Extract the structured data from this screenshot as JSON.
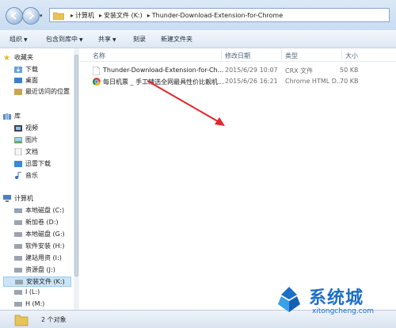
{
  "window": {
    "accent": "#cce4f7"
  },
  "breadcrumb": {
    "items": [
      "计算机",
      "安装文件 (K:)",
      "Thunder-Download-Extension-for-Chrome"
    ]
  },
  "toolbar": {
    "organize": "组织",
    "include_in_library": "包含到库中",
    "share": "共享",
    "burn": "刻录",
    "new_folder": "新建文件夹"
  },
  "nav": {
    "favorites": {
      "label": "收藏夹",
      "items": [
        "下载",
        "桌面",
        "最近访问的位置"
      ]
    },
    "libraries": {
      "label": "库",
      "items": [
        "视频",
        "图片",
        "文档",
        "迅雷下载",
        "音乐"
      ]
    },
    "computer": {
      "label": "计算机",
      "items": [
        "本地磁盘 (C:)",
        "新加卷 (D:)",
        "本地磁盘 (G:)",
        "软件安装 (H:)",
        "建站用资 (I:)",
        "资源盘 (J:)",
        "安装文件 (K:)",
        "I (L:)",
        "H (M:)"
      ],
      "selected": "安装文件 (K:)"
    }
  },
  "columns": {
    "name": "名称",
    "modified": "修改日期",
    "type": "类型",
    "size": "大小"
  },
  "files": [
    {
      "name": "Thunder-Download-Extension-for-Ch...",
      "modified": "2015/6/29 10:07",
      "type": "CRX 文件",
      "size": "50 KB",
      "icon": "crx-file-icon"
    },
    {
      "name": "每日机票 _ 手工精选全网最具性价比靓机...",
      "modified": "2015/6/26 16:21",
      "type": "Chrome HTML D...",
      "size": "70 KB",
      "icon": "chrome-icon"
    }
  ],
  "status": {
    "count": "2 个对象"
  },
  "watermark": {
    "brand": "系统城",
    "url": "xitongcheng.com"
  }
}
